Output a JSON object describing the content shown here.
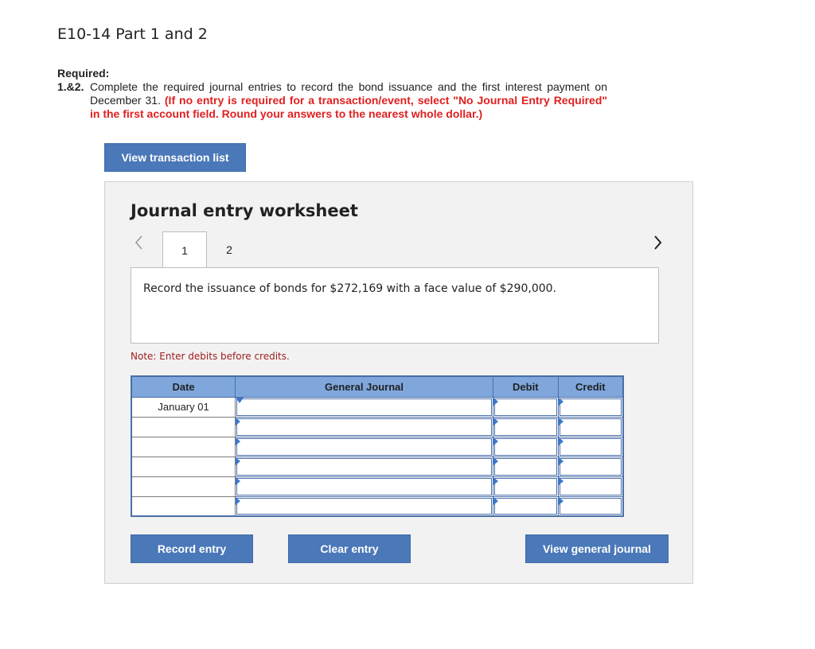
{
  "header": {
    "title": "E10-14 Part 1 and 2"
  },
  "requirement": {
    "heading": "Required:",
    "number": "1.&2.",
    "text": "Complete the required journal entries to record the bond issuance and the first interest payment on December 31.",
    "instruction": "(If no entry is required for a transaction/event, select \"No Journal Entry Required\" in the first account field. Round your answers to the nearest whole dollar.)"
  },
  "buttons": {
    "view_transaction_list": "View transaction list",
    "record_entry": "Record entry",
    "clear_entry": "Clear entry",
    "view_general_journal": "View general journal"
  },
  "worksheet": {
    "title": "Journal entry worksheet",
    "tabs": [
      "1",
      "2"
    ],
    "active_tab": "1",
    "description": "Record the issuance of bonds for $272,169 with a face value of $290,000.",
    "note": "Note: Enter debits before credits."
  },
  "table": {
    "headers": {
      "date": "Date",
      "general_journal": "General Journal",
      "debit": "Debit",
      "credit": "Credit"
    },
    "rows": [
      {
        "date": "January 01",
        "account": "",
        "debit": "",
        "credit": ""
      },
      {
        "date": "",
        "account": "",
        "debit": "",
        "credit": ""
      },
      {
        "date": "",
        "account": "",
        "debit": "",
        "credit": ""
      },
      {
        "date": "",
        "account": "",
        "debit": "",
        "credit": ""
      },
      {
        "date": "",
        "account": "",
        "debit": "",
        "credit": ""
      },
      {
        "date": "",
        "account": "",
        "debit": "",
        "credit": ""
      }
    ]
  },
  "icons": {
    "prev": "chevron-left-icon",
    "next": "chevron-right-icon"
  },
  "colors": {
    "button": "#4a78b8",
    "table_header": "#7fa7dc",
    "instruction_red": "#e02020",
    "note": "#a02020"
  }
}
